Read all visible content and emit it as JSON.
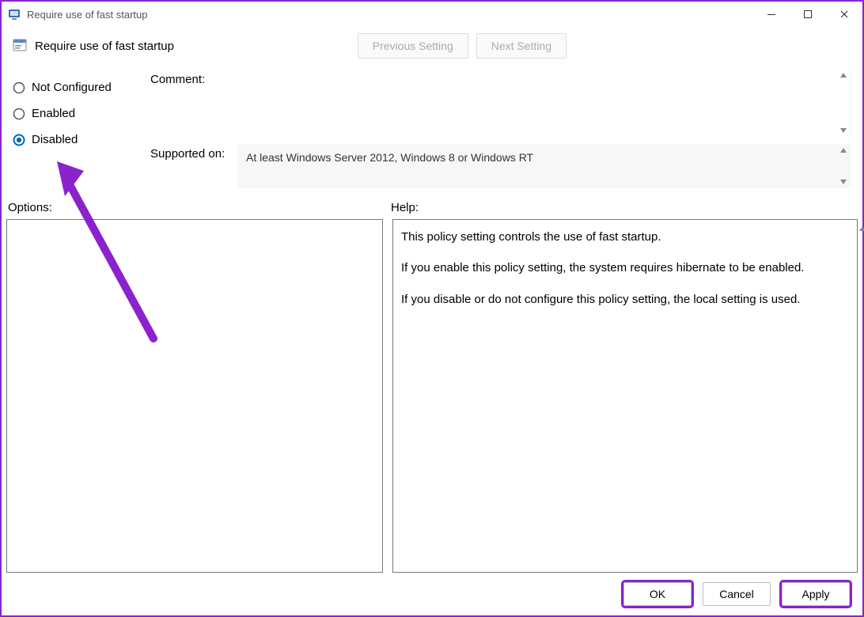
{
  "window": {
    "title": "Require use of fast startup"
  },
  "header": {
    "page_title": "Require use of fast startup"
  },
  "nav": {
    "previous": "Previous Setting",
    "next": "Next Setting"
  },
  "radios": {
    "not_configured": "Not Configured",
    "enabled": "Enabled",
    "disabled": "Disabled",
    "selected": "disabled"
  },
  "form": {
    "comment_label": "Comment:",
    "comment_value": "",
    "supported_label": "Supported on:",
    "supported_value": "At least Windows Server 2012, Windows 8 or Windows RT"
  },
  "panes": {
    "options_label": "Options:",
    "help_label": "Help:",
    "help_paragraphs": [
      "This policy setting controls the use of fast startup.",
      "If you enable this policy setting, the system requires hibernate to be enabled.",
      "If you disable or do not configure this policy setting, the local setting is used."
    ]
  },
  "footer": {
    "ok": "OK",
    "cancel": "Cancel",
    "apply": "Apply"
  }
}
